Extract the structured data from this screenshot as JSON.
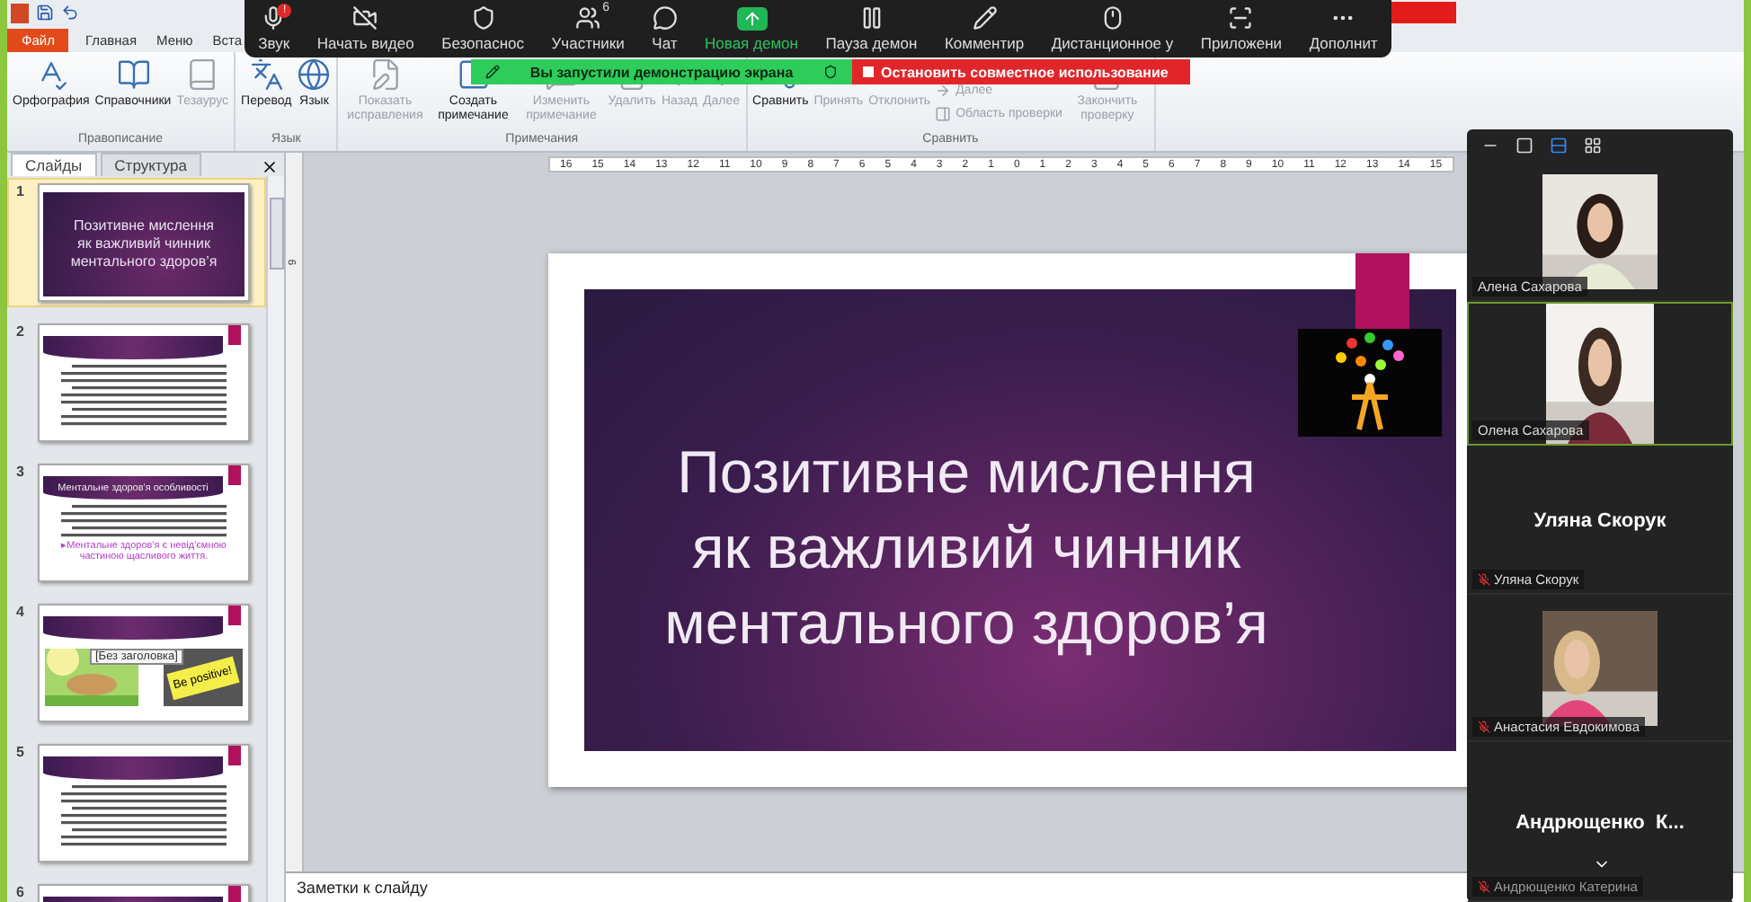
{
  "ribbon_tabs": [
    {
      "label": "Файл",
      "kind": "file"
    },
    {
      "label": "Главная",
      "kind": "tab"
    },
    {
      "label": "Меню",
      "kind": "tab"
    },
    {
      "label": "Вста",
      "kind": "tab"
    }
  ],
  "ribbon_groups": [
    {
      "label": "Правописание",
      "buttons": [
        {
          "label": "Орфография",
          "kind": "large",
          "disabled": false
        },
        {
          "label": "Справочники",
          "kind": "large",
          "disabled": false
        },
        {
          "label": "Тезаурус",
          "kind": "large",
          "disabled": true
        }
      ]
    },
    {
      "label": "Язык",
      "buttons": [
        {
          "label": "Перевод",
          "kind": "large",
          "disabled": false
        },
        {
          "label": "Язык",
          "kind": "large",
          "disabled": false
        }
      ]
    },
    {
      "label": "Примечания",
      "buttons": [
        {
          "label": "Показать исправления",
          "kind": "large",
          "disabled": true
        },
        {
          "label": "Создать примечание",
          "kind": "large",
          "disabled": false
        },
        {
          "label": "Изменить примечание",
          "kind": "large",
          "disabled": true
        },
        {
          "label": "Удалить",
          "kind": "large",
          "disabled": true
        },
        {
          "label": "Назад",
          "kind": "large",
          "disabled": true
        },
        {
          "label": "Далее",
          "kind": "large",
          "disabled": true
        }
      ]
    },
    {
      "label": "Сравнить",
      "buttons": [
        {
          "label": "Сравнить",
          "kind": "large",
          "disabled": false
        },
        {
          "label": "Принять",
          "kind": "large",
          "disabled": true
        },
        {
          "label": "Отклонить",
          "kind": "large",
          "disabled": true
        },
        {
          "label": "Далее",
          "kind": "small",
          "disabled": true
        },
        {
          "label": "Область проверки",
          "kind": "small",
          "disabled": true
        },
        {
          "label": "Закончить проверку",
          "kind": "large",
          "disabled": true
        }
      ]
    }
  ],
  "meeting_toolbar": [
    {
      "label": "Звук",
      "kind": "normal",
      "badge": "!"
    },
    {
      "label": "Начать видео",
      "kind": "normal"
    },
    {
      "label": "Безопаснос",
      "kind": "normal"
    },
    {
      "label": "Участники",
      "kind": "normal",
      "count": "6"
    },
    {
      "label": "Чат",
      "kind": "normal"
    },
    {
      "label": "Новая демон",
      "kind": "share"
    },
    {
      "label": "Пауза демон",
      "kind": "normal"
    },
    {
      "label": "Комментир",
      "kind": "normal"
    },
    {
      "label": "Дистанционное у",
      "kind": "normal"
    },
    {
      "label": "Приложени",
      "kind": "normal"
    },
    {
      "label": "Дополнит",
      "kind": "normal"
    }
  ],
  "share_banner": {
    "text": "Вы запустили демонстрацию экрана",
    "stop_button": "Остановить совместное использование"
  },
  "slides_panel": {
    "tabs": [
      {
        "label": "Слайды",
        "selected": true
      },
      {
        "label": "Структура",
        "selected": false
      }
    ],
    "thumbnails": [
      {
        "number": "1",
        "selected": true,
        "kind": "title",
        "title": "Позитивне мислення\nяк важливий чинник\nментального здоров’я"
      },
      {
        "number": "2",
        "selected": false,
        "kind": "text"
      },
      {
        "number": "3",
        "selected": false,
        "kind": "titled",
        "title": "Ментальне здоров'я особливості",
        "highlight": "▸Ментальне здоров'я є невід'ємною частиною щасливого життя."
      },
      {
        "number": "4",
        "selected": false,
        "kind": "pictures",
        "tooltip": "[Без заголовка]",
        "note": "Be positive!"
      },
      {
        "number": "5",
        "selected": false,
        "kind": "text"
      },
      {
        "number": "6",
        "selected": false,
        "kind": "text"
      }
    ]
  },
  "ruler": {
    "horizontal": [
      "16",
      "15",
      "14",
      "13",
      "12",
      "11",
      "10",
      "9",
      "8",
      "7",
      "6",
      "5",
      "4",
      "3",
      "2",
      "1",
      "0",
      "1",
      "2",
      "3",
      "4",
      "5",
      "6",
      "7",
      "8",
      "9",
      "10",
      "11",
      "12",
      "13",
      "14",
      "15"
    ],
    "vertical": [
      "9"
    ]
  },
  "slide": {
    "title": "Позитивне мислення\nяк важливий чинник\nментального здоров’я"
  },
  "notes": {
    "placeholder": "Заметки к слайду"
  },
  "video_panel": {
    "view_modes": [
      {
        "selected": false
      },
      {
        "selected": false
      },
      {
        "selected": true
      },
      {
        "selected": false
      }
    ],
    "participants": [
      {
        "name": "Алена Сахарова",
        "kind": "video",
        "muted": false,
        "active": false
      },
      {
        "name": "Олена Сахарова",
        "kind": "video",
        "muted": false,
        "active": true
      },
      {
        "name": "Уляна Скорук",
        "display": "Уляна Скорук",
        "kind": "name",
        "muted": true,
        "active": false
      },
      {
        "name": "Анастасия Евдокимова",
        "kind": "video",
        "muted": true,
        "active": false
      },
      {
        "name": "Андрющенко Катерина",
        "display": "Андрющенко  К...",
        "kind": "name",
        "muted": true,
        "active": false
      }
    ]
  }
}
